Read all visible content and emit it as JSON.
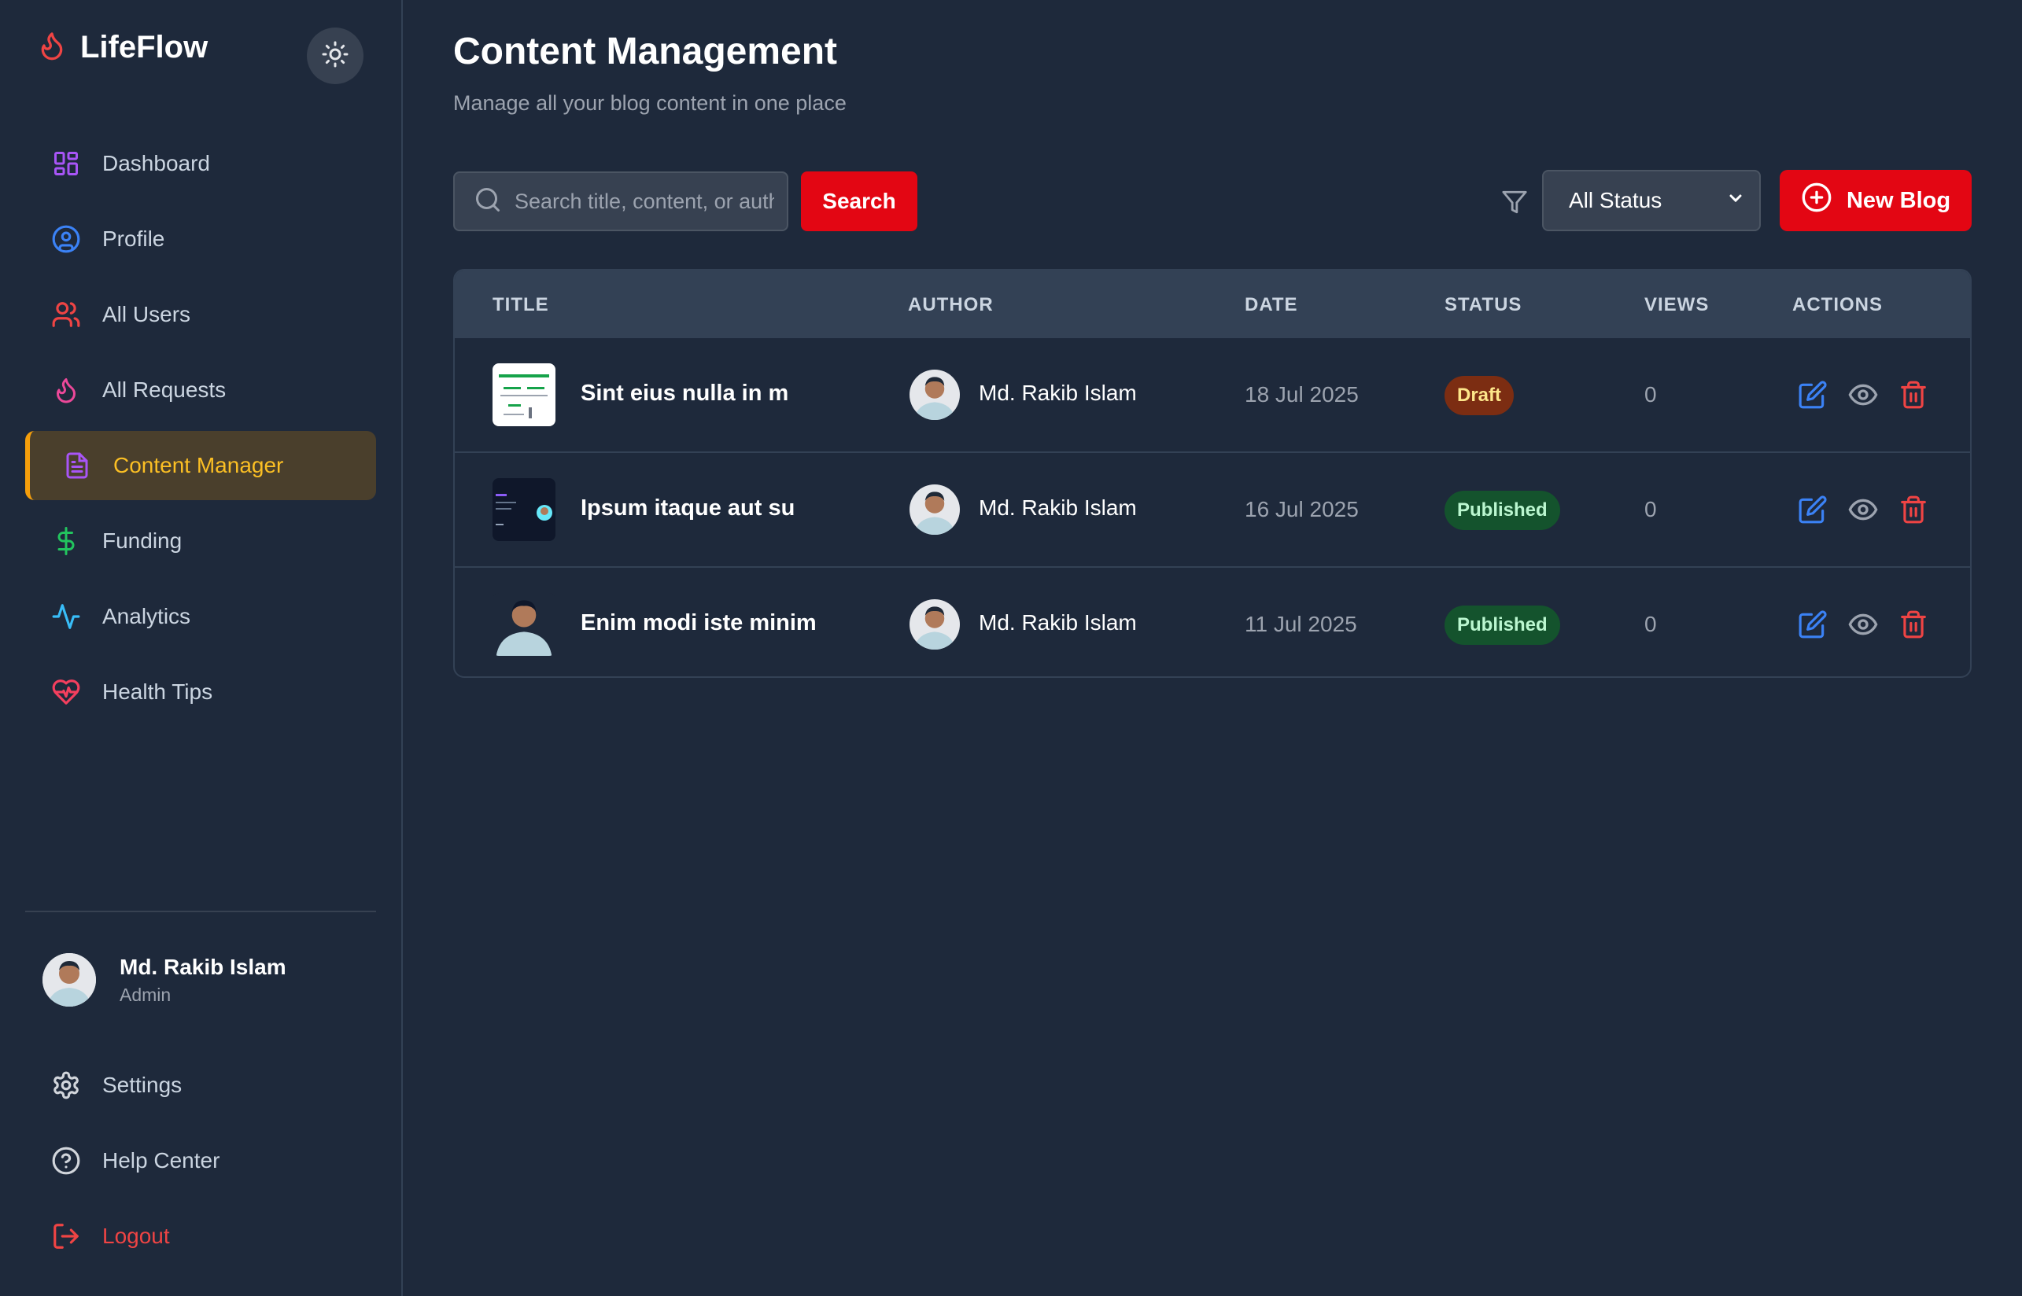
{
  "brand": {
    "name": "LifeFlow"
  },
  "sidebar": {
    "items": [
      {
        "label": "Dashboard",
        "icon": "dashboard-icon",
        "color": "#a855f7"
      },
      {
        "label": "Profile",
        "icon": "user-circle-icon",
        "color": "#3b82f6"
      },
      {
        "label": "All Users",
        "icon": "users-icon",
        "color": "#ef4444"
      },
      {
        "label": "All Requests",
        "icon": "drop-icon",
        "color": "#ec4899"
      },
      {
        "label": "Content Manager",
        "icon": "document-icon",
        "color": "#a855f7",
        "active": true
      },
      {
        "label": "Funding",
        "icon": "dollar-icon",
        "color": "#22c55e"
      },
      {
        "label": "Analytics",
        "icon": "activity-icon",
        "color": "#38bdf8"
      },
      {
        "label": "Health Tips",
        "icon": "heart-pulse-icon",
        "color": "#f43f5e"
      }
    ],
    "user": {
      "name": "Md. Rakib Islam",
      "role": "Admin"
    },
    "bottom": [
      {
        "label": "Settings",
        "icon": "gear-icon"
      },
      {
        "label": "Help Center",
        "icon": "help-icon"
      },
      {
        "label": "Logout",
        "icon": "logout-icon"
      }
    ]
  },
  "main": {
    "title": "Content Management",
    "subtitle": "Manage all your blog content in one place",
    "search": {
      "placeholder": "Search title, content, or author",
      "button": "Search"
    },
    "filter": {
      "selected": "All Status"
    },
    "new_button": "New Blog"
  },
  "table": {
    "headers": [
      "TITLE",
      "AUTHOR",
      "DATE",
      "STATUS",
      "VIEWS",
      "ACTIONS"
    ],
    "rows": [
      {
        "title": "Sint eius nulla in m",
        "author": "Md. Rakib Islam",
        "date": "18 Jul 2025",
        "status": "Draft",
        "views": "0"
      },
      {
        "title": "Ipsum itaque aut su",
        "author": "Md. Rakib Islam",
        "date": "16 Jul 2025",
        "status": "Published",
        "views": "0"
      },
      {
        "title": "Enim modi iste minim",
        "author": "Md. Rakib Islam",
        "date": "11 Jul 2025",
        "status": "Published",
        "views": "0"
      }
    ]
  },
  "colors": {
    "accent": "#e30613",
    "active": "#f59e0b",
    "background": "#1e293b"
  }
}
